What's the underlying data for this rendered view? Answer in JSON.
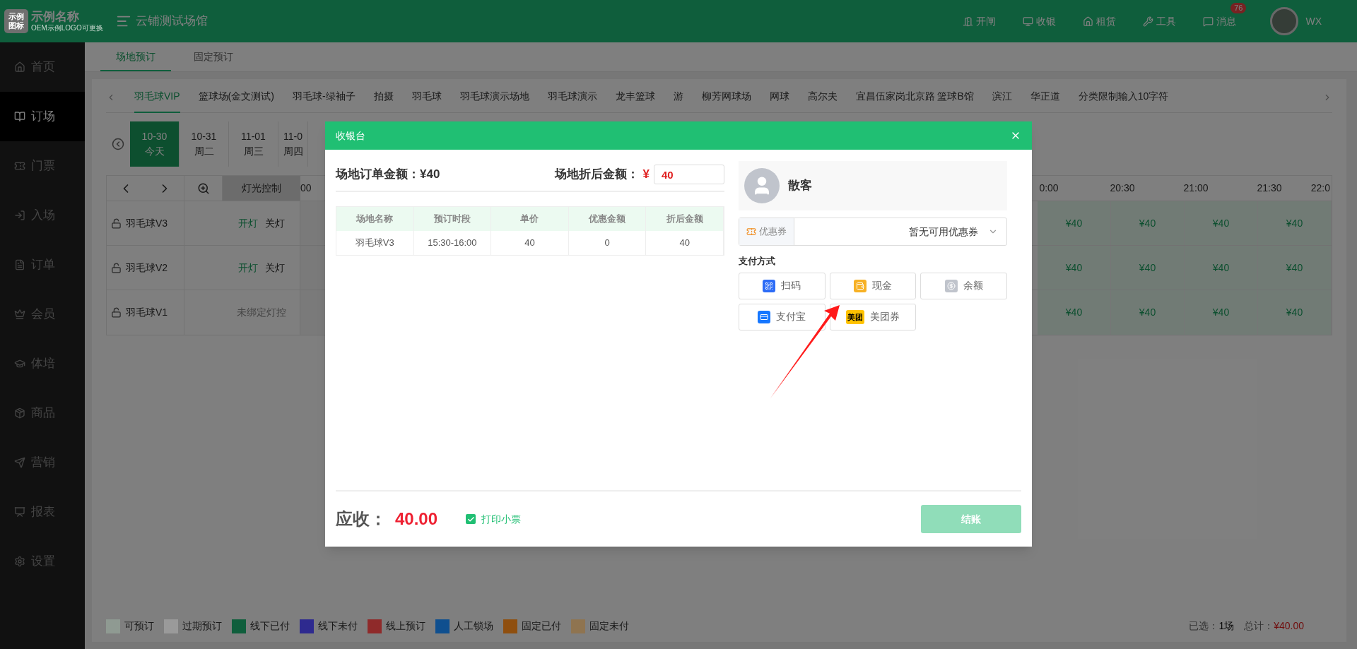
{
  "header": {
    "logo_mark": "示例图标",
    "brand": "示例名称",
    "brand_sub": "OEM示例LOGO可更换",
    "venue": "云铺测试场馆",
    "actions": [
      {
        "label": "开闸"
      },
      {
        "label": "收银"
      },
      {
        "label": "租赁"
      },
      {
        "label": "工具"
      },
      {
        "label": "消息",
        "badge": "76"
      }
    ],
    "user": "WX"
  },
  "sidebar": {
    "items": [
      {
        "label": "首页",
        "selected": false
      },
      {
        "label": "订场",
        "selected": true
      },
      {
        "label": "门票",
        "selected": false
      },
      {
        "label": "入场",
        "selected": false
      },
      {
        "label": "订单",
        "selected": false
      },
      {
        "label": "会员",
        "selected": false
      },
      {
        "label": "体培",
        "selected": false
      },
      {
        "label": "商品",
        "selected": false
      },
      {
        "label": "营销",
        "selected": false
      },
      {
        "label": "报表",
        "selected": false
      },
      {
        "label": "设置",
        "selected": false
      }
    ]
  },
  "page_tabs": [
    {
      "label": "场地预订",
      "selected": true
    },
    {
      "label": "固定预订",
      "selected": false
    }
  ],
  "category_tabs": [
    {
      "label": "羽毛球VIP",
      "selected": true
    },
    {
      "label": "篮球场(金文测试)",
      "selected": false
    },
    {
      "label": "羽毛球-绿袖子",
      "selected": false
    },
    {
      "label": "拍摄",
      "selected": false
    },
    {
      "label": "羽毛球",
      "selected": false
    },
    {
      "label": "羽毛球演示场地",
      "selected": false
    },
    {
      "label": "羽毛球演示",
      "selected": false
    },
    {
      "label": "龙丰篮球",
      "selected": false
    },
    {
      "label": "游",
      "selected": false
    },
    {
      "label": "柳芳网球场",
      "selected": false
    },
    {
      "label": "网球",
      "selected": false
    },
    {
      "label": "高尔夫",
      "selected": false
    },
    {
      "label": "宜昌伍家岗北京路 篮球B馆",
      "selected": false
    },
    {
      "label": "滨江",
      "selected": false
    },
    {
      "label": "华正道",
      "selected": false
    },
    {
      "label": "分类限制输入10字符",
      "selected": false
    }
  ],
  "dates": [
    {
      "date": "10-30",
      "weekday": "今天",
      "selected": true
    },
    {
      "date": "10-31",
      "weekday": "周二",
      "selected": false
    },
    {
      "date": "11-01",
      "weekday": "周三",
      "selected": false
    },
    {
      "date": "11-0",
      "weekday": "周四",
      "selected": false
    }
  ],
  "schedule": {
    "light_header": "灯光控制",
    "times": [
      "00",
      "0:00",
      "20:30",
      "21:00",
      "21:30",
      "22:0"
    ],
    "rows": [
      {
        "name": "羽毛球V3",
        "locked": false,
        "light": [
          {
            "kind": "on",
            "label": "开灯"
          },
          {
            "kind": "off",
            "label": "关灯"
          }
        ],
        "prices": [
          "¥40",
          "¥40",
          "¥40",
          "¥40"
        ]
      },
      {
        "name": "羽毛球V2",
        "locked": false,
        "light": [
          {
            "kind": "on",
            "label": "开灯"
          },
          {
            "kind": "off",
            "label": "关灯"
          }
        ],
        "prices": [
          "¥40",
          "¥40",
          "¥40",
          "¥40"
        ]
      },
      {
        "name": "羽毛球V1",
        "locked": false,
        "light": [
          {
            "kind": "note",
            "label": "未绑定灯控"
          }
        ],
        "prices": [
          "¥40",
          "¥40",
          "¥40",
          "¥40"
        ]
      }
    ]
  },
  "legend": [
    {
      "label": "可预订",
      "color": "#8f9a92"
    },
    {
      "label": "过期预订",
      "color": "#9a9a9a"
    },
    {
      "label": "线下已付",
      "color": "#0f5e3c"
    },
    {
      "label": "线下未付",
      "color": "#2e2a8f"
    },
    {
      "label": "线上预订",
      "color": "#8f2a2a"
    },
    {
      "label": "人工锁场",
      "color": "#0f4f8f"
    },
    {
      "label": "固定已付",
      "color": "#8f4f0f"
    },
    {
      "label": "固定未付",
      "color": "#8f7450"
    }
  ],
  "summary": {
    "selected_label": "已选：",
    "selected_value": "1场",
    "total_label": "总计：",
    "total_value": "¥40.00"
  },
  "cashier": {
    "title": "收银台",
    "order_amount_label": "场地订单金额：",
    "order_amount": "¥40",
    "discount_label": "场地折后金额：",
    "currency": "¥",
    "discount_value": "40",
    "table": {
      "columns": [
        "场地名称",
        "预订时段",
        "单价",
        "优惠金额",
        "折后金额"
      ],
      "rows": [
        [
          "羽毛球V3",
          "15:30-16:00",
          "40",
          "0",
          "40"
        ]
      ]
    },
    "customer": "散客",
    "coupon": {
      "label": "优惠券",
      "value": "暂无可用优惠券"
    },
    "payment_title": "支付方式",
    "payments": [
      {
        "kind": "scan",
        "label": "扫码"
      },
      {
        "kind": "cash",
        "label": "现金"
      },
      {
        "kind": "balance",
        "label": "余额"
      },
      {
        "kind": "alipay",
        "label": "支付宝"
      },
      {
        "kind": "meituan",
        "label": "美团券",
        "badge": "美团"
      }
    ],
    "due_label": "应收：",
    "due_value": "40.00",
    "print_receipt": {
      "label": "打印小票",
      "checked": true
    },
    "checkout": {
      "label": "结账",
      "disabled": true
    }
  }
}
